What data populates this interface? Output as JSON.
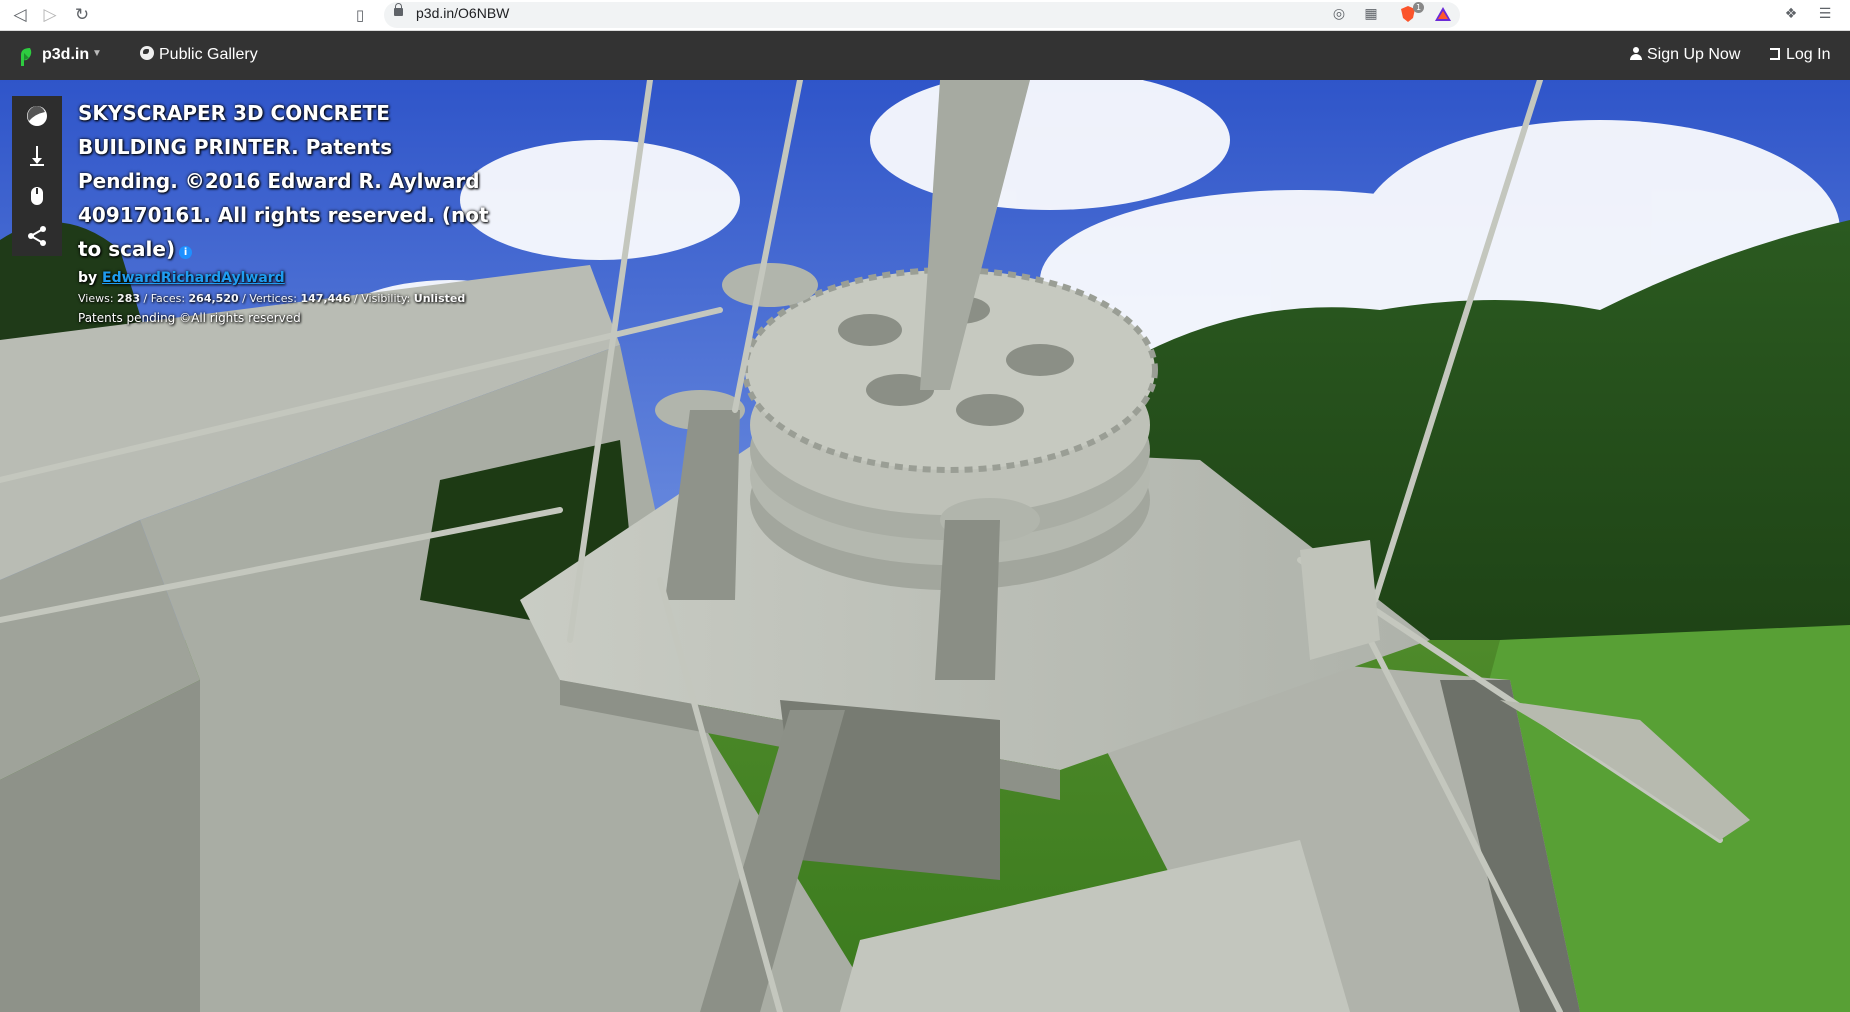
{
  "browser": {
    "url": "p3d.in/O6NBW",
    "ext_badge": "1"
  },
  "nav": {
    "logo_text": "p3d.in",
    "gallery_label": "Public Gallery",
    "signup_label": "Sign Up Now",
    "login_label": "Log In"
  },
  "model": {
    "title": "SKYSCRAPER 3D CONCRETE BUILDING PRINTER. Patents Pending. ©2016 Edward R. Aylward 409170161. All rights reserved. (not to scale)",
    "by_label": "by",
    "author": "EdwardRichardAylward",
    "views_label": "Views:",
    "views": "283",
    "faces_label": "Faces:",
    "faces": "264,520",
    "vertices_label": "Vertices:",
    "vertices": "147,446",
    "visibility_label": "Visibility:",
    "visibility": "Unlisted",
    "license": "Patents pending ©All rights reserved"
  },
  "toolbar": {
    "icons": [
      "material-icon",
      "light-icon",
      "mouse-icon",
      "share-icon"
    ]
  },
  "colors": {
    "nav_bg": "#333333",
    "author_link": "#1f9cf0",
    "logo_green": "#2ecc40",
    "info_icon": "#1e90ff"
  }
}
